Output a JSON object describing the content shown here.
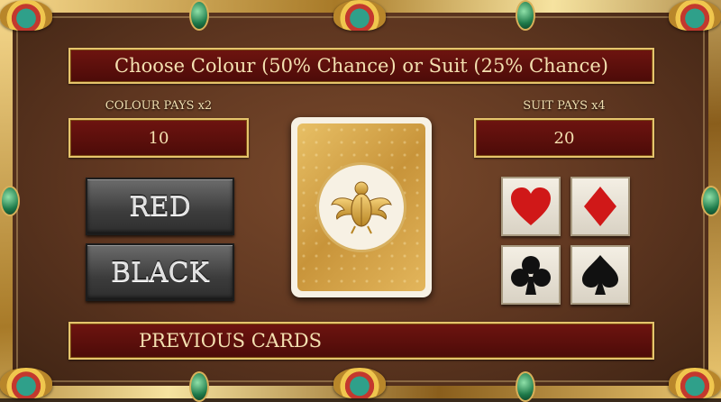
{
  "header": {
    "title": "Choose Colour (50% Chance) or Suit (25% Chance)"
  },
  "colour": {
    "label": "COLOUR PAYS x2",
    "value": "10"
  },
  "suit": {
    "label": "SUIT PAYS x4",
    "value": "20"
  },
  "buttons": {
    "red": "RED",
    "black": "BLACK"
  },
  "card": {
    "emblem": "scarab-icon"
  },
  "suits": [
    {
      "name": "heart-icon",
      "color": "#d01818"
    },
    {
      "name": "diamond-icon",
      "color": "#d01818"
    },
    {
      "name": "club-icon",
      "color": "#111111"
    },
    {
      "name": "spade-icon",
      "color": "#111111"
    }
  ],
  "footer": {
    "previous_label": "PREVIOUS CARDS"
  },
  "colors": {
    "banner": "#5a0f0c",
    "gold": "#e6c46c",
    "button": "#4a4a4a"
  }
}
